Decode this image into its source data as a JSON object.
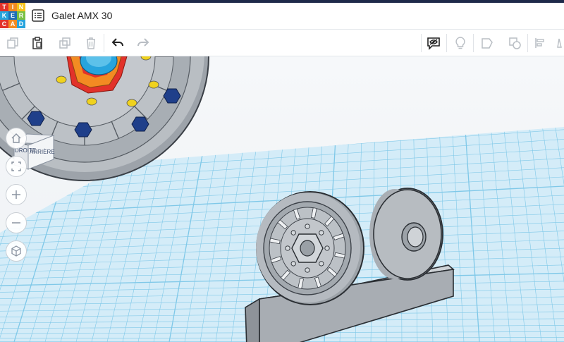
{
  "app": {
    "logo_letters": [
      "T",
      "I",
      "N",
      "K",
      "E",
      "R",
      "C",
      "A",
      "D"
    ],
    "logo_colors": [
      "#e2322a",
      "#f38b22",
      "#f5c21b",
      "#27a4dd",
      "#1e6fb8",
      "#7ac143",
      "#e2322a",
      "#f38b22",
      "#27a4dd"
    ],
    "design_title": "Galet AMX 30"
  },
  "viewcube": {
    "left_face": "DROITE",
    "front_face": "ARRIÈRE"
  },
  "colors": {
    "grid_line": "#7fc8e8",
    "grid_bg": "#d7eef9",
    "model_fill": "#b7bcc2",
    "model_stroke": "#3a3f46",
    "accent_dark": "#1e2a4a"
  }
}
